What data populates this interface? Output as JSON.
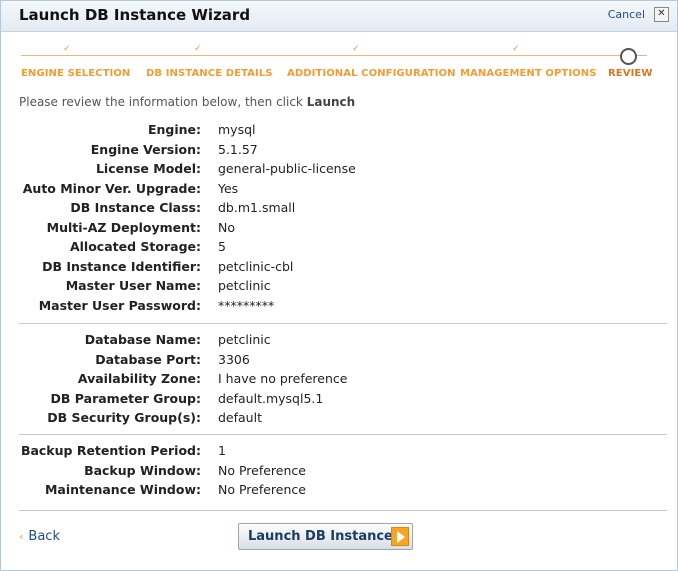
{
  "window": {
    "title": "Launch DB Instance Wizard",
    "cancel_label": "Cancel",
    "close_glyph": "✕"
  },
  "steps": [
    {
      "label": "ENGINE SELECTION"
    },
    {
      "label": "DB INSTANCE DETAILS"
    },
    {
      "label": "ADDITIONAL CONFIGURATION"
    },
    {
      "label": "MANAGEMENT OPTIONS"
    },
    {
      "label": "REVIEW"
    }
  ],
  "instructions": {
    "text": "Please review the information below, then click ",
    "emph": "Launch"
  },
  "groups": [
    [
      {
        "label": "Engine:",
        "value": "mysql"
      },
      {
        "label": "Engine Version:",
        "value": "5.1.57"
      },
      {
        "label": "License Model:",
        "value": "general-public-license"
      },
      {
        "label": "Auto Minor Ver. Upgrade:",
        "value": "Yes"
      },
      {
        "label": "DB Instance Class:",
        "value": "db.m1.small"
      },
      {
        "label": "Multi-AZ Deployment:",
        "value": "No"
      },
      {
        "label": "Allocated Storage:",
        "value": "5"
      },
      {
        "label": "DB Instance Identifier:",
        "value": "petclinic-cbl"
      },
      {
        "label": "Master User Name:",
        "value": "petclinic"
      },
      {
        "label": "Master User Password:",
        "value": "*********"
      }
    ],
    [
      {
        "label": "Database Name:",
        "value": "petclinic"
      },
      {
        "label": "Database Port:",
        "value": "3306"
      },
      {
        "label": "Availability Zone:",
        "value": "I have no preference"
      },
      {
        "label": "DB Parameter Group:",
        "value": "default.mysql5.1"
      },
      {
        "label": "DB Security Group(s):",
        "value": "default"
      }
    ],
    [
      {
        "label": "Backup Retention Period:",
        "value": "1"
      },
      {
        "label": "Backup Window:",
        "value": "No Preference"
      },
      {
        "label": "Maintenance Window:",
        "value": "No Preference"
      }
    ]
  ],
  "footer": {
    "back_label": "Back",
    "back_glyph": "‹",
    "launch_label": "Launch DB Instance"
  }
}
